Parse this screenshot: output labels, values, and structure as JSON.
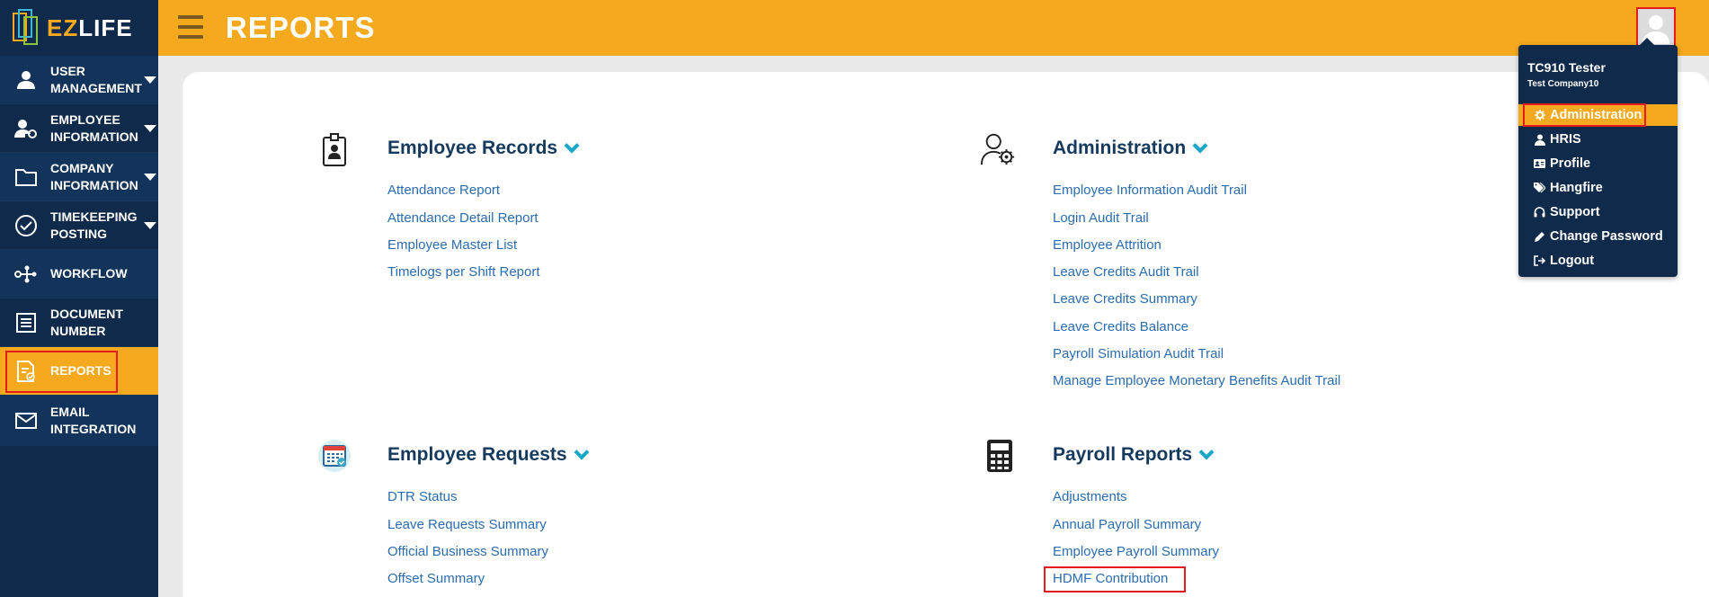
{
  "app": {
    "logo_prefix": "EZ",
    "logo_suffix": "LIFE"
  },
  "header": {
    "title": "REPORTS"
  },
  "sidebar": {
    "items": [
      {
        "label": "USER MANAGEMENT",
        "icon": "user-icon",
        "has_caret": true
      },
      {
        "label": "EMPLOYEE INFORMATION",
        "icon": "employee-info-icon",
        "has_caret": true
      },
      {
        "label": "COMPANY INFORMATION",
        "icon": "folder-icon",
        "has_caret": true
      },
      {
        "label": "TIMEKEEPING POSTING",
        "icon": "check-circle-icon",
        "has_caret": true
      },
      {
        "label": "WORKFLOW",
        "icon": "workflow-icon",
        "has_caret": false
      },
      {
        "label": "DOCUMENT NUMBER",
        "icon": "list-icon",
        "has_caret": false
      },
      {
        "label": "REPORTS",
        "icon": "report-icon",
        "has_caret": false,
        "active": true
      },
      {
        "label": "EMAIL INTEGRATION",
        "icon": "envelope-icon",
        "has_caret": false
      }
    ]
  },
  "sections": {
    "employee_records": {
      "title": "Employee Records",
      "icon": "id-card-icon",
      "links": [
        "Attendance Report",
        "Attendance Detail Report",
        "Employee Master List",
        "Timelogs per Shift Report"
      ]
    },
    "administration": {
      "title": "Administration",
      "icon": "user-gear-icon",
      "links": [
        "Employee Information Audit Trail",
        "Login Audit Trail",
        "Employee Attrition",
        "Leave Credits Audit Trail",
        "Leave Credits Summary",
        "Leave Credits Balance",
        "Payroll Simulation Audit Trail",
        "Manage Employee Monetary Benefits Audit Trail"
      ]
    },
    "employee_requests": {
      "title": "Employee Requests",
      "icon": "calendar-check-icon",
      "links": [
        "DTR Status",
        "Leave Requests Summary",
        "Official Business Summary",
        "Offset Summary"
      ]
    },
    "payroll_reports": {
      "title": "Payroll Reports",
      "icon": "calculator-icon",
      "links": [
        "Adjustments",
        "Annual Payroll Summary",
        "Employee Payroll Summary",
        "HDMF Contribution"
      ]
    }
  },
  "user_menu": {
    "name": "TC910 Tester",
    "company": "Test Company10",
    "items": [
      {
        "label": "Administration",
        "icon": "gear-icon",
        "active": true
      },
      {
        "label": "HRIS",
        "icon": "user-icon"
      },
      {
        "label": "Profile",
        "icon": "id-card-icon"
      },
      {
        "label": "Hangfire",
        "icon": "tags-icon"
      },
      {
        "label": "Support",
        "icon": "headset-icon"
      },
      {
        "label": "Change Password",
        "icon": "pencil-icon"
      },
      {
        "label": "Logout",
        "icon": "sign-out-icon"
      }
    ]
  },
  "colors": {
    "sidebar": "#0f2a4a",
    "accent": "#f5a91f",
    "link": "#2b6cb0",
    "section_title": "#153a5e",
    "chevron": "#1ba6c9",
    "highlight": "#e31d1d"
  }
}
